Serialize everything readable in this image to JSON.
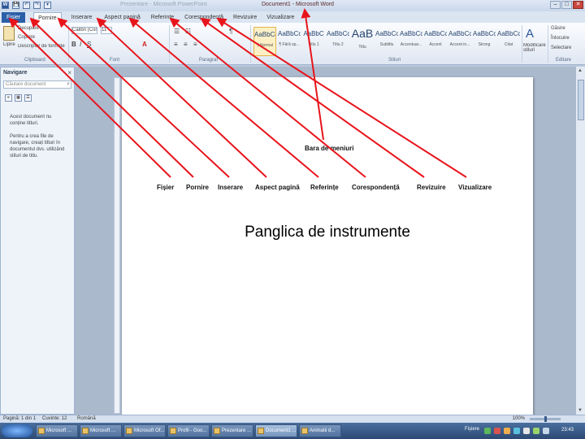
{
  "window": {
    "title": "Document1 - Microsoft Word",
    "ghost_title": "Prezentare - Microsoft PowerPoint",
    "controls": [
      "–",
      "□",
      "✕"
    ]
  },
  "quick_access": [
    "W",
    "💾",
    "↶",
    "↷",
    "▾"
  ],
  "tabs": [
    {
      "label": "Fișier",
      "kind": "file"
    },
    {
      "label": "Pornire",
      "kind": "active"
    },
    {
      "label": "Inserare",
      "kind": "normal"
    },
    {
      "label": "Aspect pagină",
      "kind": "normal"
    },
    {
      "label": "Referințe",
      "kind": "normal"
    },
    {
      "label": "Corespondență",
      "kind": "normal"
    },
    {
      "label": "Revizuire",
      "kind": "normal"
    },
    {
      "label": "Vizualizare",
      "kind": "normal"
    }
  ],
  "ribbon": {
    "clipboard": {
      "paste": "Lipire",
      "cut": "Decupare",
      "copy": "Copiere",
      "format_painter": "Descriptor de formate",
      "label": "Clipboard"
    },
    "font": {
      "family": "Calibri (Corp)",
      "size": "11",
      "label": "Font"
    },
    "paragraph": {
      "label": "Paragraf"
    },
    "styles": {
      "label": "Stiluri",
      "items": [
        {
          "sample": "AaBbCcDc",
          "name": "¶ Normal",
          "selected": true
        },
        {
          "sample": "AaBbCcDc",
          "name": "¶ Fără sp...",
          "selected": false
        },
        {
          "sample": "AaBbC",
          "name": "Titlu 1",
          "selected": false
        },
        {
          "sample": "AaBbCc",
          "name": "Titlu 2",
          "selected": false
        },
        {
          "sample": "AaB",
          "name": "Titlu",
          "selected": false,
          "big": true
        },
        {
          "sample": "AaBbCcI",
          "name": "Subtitlu",
          "selected": false
        },
        {
          "sample": "AaBbCcDc",
          "name": "Accentuar...",
          "selected": false
        },
        {
          "sample": "AaBbCcDc",
          "name": "Accent",
          "selected": false
        },
        {
          "sample": "AaBbCcDc",
          "name": "Accent in...",
          "selected": false
        },
        {
          "sample": "AaBbCcDc",
          "name": "Strong",
          "selected": false
        },
        {
          "sample": "AaBbCcDc",
          "name": "Citat",
          "selected": false
        }
      ],
      "change_styles": "Modificare stiluri"
    },
    "editing": {
      "find": "Găsire",
      "replace": "Înlocuire",
      "select": "Selectare",
      "label": "Editare"
    }
  },
  "nav_pane": {
    "title": "Navigare",
    "search_placeholder": "Căutare document",
    "message1": "Acest document nu conține titluri.",
    "message2": "Pentru a crea file de navigare, creați titluri în documentul dvs. utilizând stiluri de titlu."
  },
  "document": {
    "title": "Panglica de instrumente",
    "labels": {
      "bara": "Bara de meniuri",
      "fisier": "Fișier",
      "pornire": "Pornire",
      "inserare": "Inserare",
      "aspect": "Aspect pagină",
      "referinte": "Referințe",
      "corespondenta": "Corespondență",
      "revizuire": "Revizuire",
      "vizualizare": "Vizualizare"
    }
  },
  "status": {
    "page": "Pagină: 1 din 1",
    "words": "Cuvinte: 12",
    "language": "Română",
    "zoom": "100%",
    "zoom_fraction": 0.5
  },
  "taskbar": {
    "items": [
      {
        "label": "Microsoft ...",
        "active": false
      },
      {
        "label": "Microsoft ...",
        "active": false
      },
      {
        "label": "Microsoft Of...",
        "active": false
      },
      {
        "label": "Profil - Goo...",
        "active": false
      },
      {
        "label": "Prezentare ...",
        "active": false
      },
      {
        "label": "Document1 ...",
        "active": true
      },
      {
        "label": "Animatii d...",
        "active": false
      }
    ],
    "tray_label": "Fișiere",
    "clock": "23:43"
  },
  "colors": {
    "arrow": "#e8141b",
    "file_tab": "#2b5fa8",
    "ribbon_bg": "#dfe7f3",
    "taskbar": "#2c4a73"
  }
}
